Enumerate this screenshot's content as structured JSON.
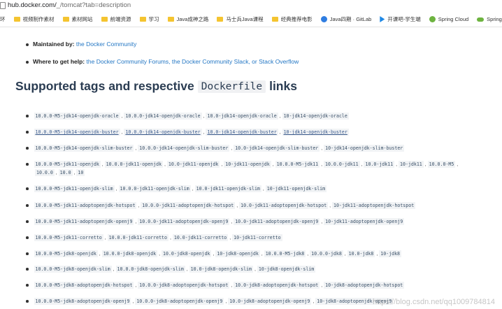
{
  "browser": {
    "url_host": "hub.docker.com/",
    "url_path": "_/tomcat?tab=description",
    "bookmarks": [
      {
        "label": "环",
        "icon": "folder-icon"
      },
      {
        "label": "视频制作素材",
        "icon": "folder-icon"
      },
      {
        "label": "素材网站",
        "icon": "folder-icon"
      },
      {
        "label": "前端资源",
        "icon": "folder-icon"
      },
      {
        "label": "学习",
        "icon": "folder-icon"
      },
      {
        "label": "Java成神之路",
        "icon": "folder-icon"
      },
      {
        "label": "马士兵Java课程",
        "icon": "folder-icon"
      },
      {
        "label": "经典推荐电影",
        "icon": "folder-icon"
      },
      {
        "label": "Java四期 · GitLab",
        "icon": "gitlab-icon"
      },
      {
        "label": "开课吧-学生端",
        "icon": "play-icon"
      },
      {
        "label": "Spring Cloud",
        "icon": "spring-icon"
      },
      {
        "label": "Spring C",
        "icon": "cloud-icon"
      }
    ]
  },
  "info": {
    "maintained_label": "Maintained by:",
    "maintained_value": "the Docker Community",
    "help_label": "Where to get help:",
    "help_value": "the Docker Community Forums, the Docker Community Slack, or Stack Overflow"
  },
  "heading": {
    "before": "Supported tags and respective",
    "code": "Dockerfile",
    "after": "links"
  },
  "tag_rows": [
    {
      "tags": [
        "10.0.0-M5-jdk14-openjdk-oracle",
        "10.0.0-jdk14-openjdk-oracle",
        "10.0-jdk14-openjdk-oracle",
        "10-jdk14-openjdk-oracle"
      ],
      "underline": false
    },
    {
      "tags": [
        "10.0.0-M5-jdk14-openjdk-buster",
        "10.0.0-jdk14-openjdk-buster",
        "10.0-jdk14-openjdk-buster",
        "10-jdk14-openjdk-buster"
      ],
      "underline": true
    },
    {
      "tags": [
        "10.0.0-M5-jdk14-openjdk-slim-buster",
        "10.0.0-jdk14-openjdk-slim-buster",
        "10.0-jdk14-openjdk-slim-buster",
        "10-jdk14-openjdk-slim-buster"
      ],
      "underline": false
    },
    {
      "tags": [
        "10.0.0-M5-jdk11-openjdk",
        "10.0.0-jdk11-openjdk",
        "10.0-jdk11-openjdk",
        "10-jdk11-openjdk",
        "10.0.0-M5-jdk11",
        "10.0.0-jdk11",
        "10.0-jdk11",
        "10-jdk11",
        "10.0.0-M5"
      ],
      "underline": false,
      "wrap": [
        "10.0.0",
        "10.0",
        "10"
      ]
    },
    {
      "tags": [
        "10.0.0-M5-jdk11-openjdk-slim",
        "10.0.0-jdk11-openjdk-slim",
        "10.0-jdk11-openjdk-slim",
        "10-jdk11-openjdk-slim"
      ],
      "underline": false
    },
    {
      "tags": [
        "10.0.0-M5-jdk11-adoptopenjdk-hotspot",
        "10.0.0-jdk11-adoptopenjdk-hotspot",
        "10.0-jdk11-adoptopenjdk-hotspot",
        "10-jdk11-adoptopenjdk-hotspot"
      ],
      "underline": false
    },
    {
      "tags": [
        "10.0.0-M5-jdk11-adoptopenjdk-openj9",
        "10.0.0-jdk11-adoptopenjdk-openj9",
        "10.0-jdk11-adoptopenjdk-openj9",
        "10-jdk11-adoptopenjdk-openj9"
      ],
      "underline": false
    },
    {
      "tags": [
        "10.0.0-M5-jdk11-corretto",
        "10.0.0-jdk11-corretto",
        "10.0-jdk11-corretto",
        "10-jdk11-corretto"
      ],
      "underline": false
    },
    {
      "tags": [
        "10.0.0-M5-jdk8-openjdk",
        "10.0.0-jdk8-openjdk",
        "10.0-jdk8-openjdk",
        "10-jdk8-openjdk",
        "10.0.0-M5-jdk8",
        "10.0.0-jdk8",
        "10.0-jdk8",
        "10-jdk8"
      ],
      "underline": false
    },
    {
      "tags": [
        "10.0.0-M5-jdk8-openjdk-slim",
        "10.0.0-jdk8-openjdk-slim",
        "10.0-jdk8-openjdk-slim",
        "10-jdk8-openjdk-slim"
      ],
      "underline": false
    },
    {
      "tags": [
        "10.0.0-M5-jdk8-adoptopenjdk-hotspot",
        "10.0.0-jdk8-adoptopenjdk-hotspot",
        "10.0-jdk8-adoptopenjdk-hotspot",
        "10-jdk8-adoptopenjdk-hotspot"
      ],
      "underline": false
    },
    {
      "tags": [
        "10.0.0-M5-jdk8-adoptopenjdk-openj9",
        "10.0.0-jdk8-adoptopenjdk-openj9",
        "10.0-jdk8-adoptopenjdk-openj9",
        "10-jdk8-adoptopenjdk-openj9"
      ],
      "underline": false
    }
  ],
  "watermark": "https://blog.csdn.net/qq1009784814",
  "colors": {
    "link": "#2477c4",
    "heading": "#2a3c52",
    "tag_bg": "#f1f3f5"
  }
}
